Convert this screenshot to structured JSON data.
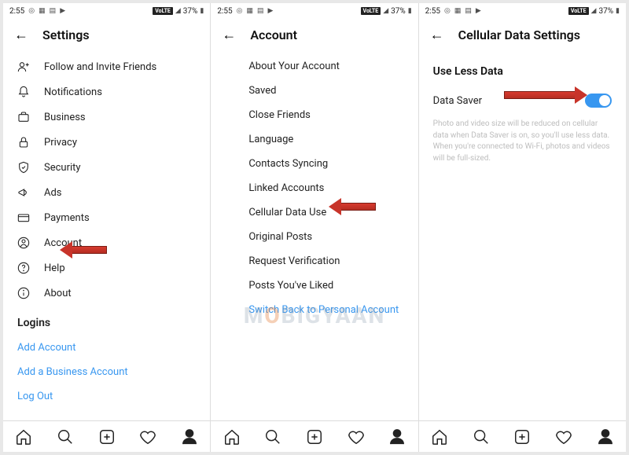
{
  "statusbar": {
    "time": "2:55",
    "network_badge": "VoLTE",
    "battery_pct": "37%"
  },
  "panel1": {
    "title": "Settings",
    "items": [
      {
        "label": "Follow and Invite Friends",
        "icon": "user-plus"
      },
      {
        "label": "Notifications",
        "icon": "bell"
      },
      {
        "label": "Business",
        "icon": "briefcase"
      },
      {
        "label": "Privacy",
        "icon": "lock"
      },
      {
        "label": "Security",
        "icon": "shield"
      },
      {
        "label": "Ads",
        "icon": "megaphone"
      },
      {
        "label": "Payments",
        "icon": "card"
      },
      {
        "label": "Account",
        "icon": "user-circle"
      },
      {
        "label": "Help",
        "icon": "help"
      },
      {
        "label": "About",
        "icon": "info"
      }
    ],
    "logins_title": "Logins",
    "logins": [
      {
        "label": "Add Account"
      },
      {
        "label": "Add a Business Account"
      },
      {
        "label": "Log Out"
      }
    ]
  },
  "panel2": {
    "title": "Account",
    "items": [
      {
        "label": "About Your Account"
      },
      {
        "label": "Saved"
      },
      {
        "label": "Close Friends"
      },
      {
        "label": "Language"
      },
      {
        "label": "Contacts Syncing"
      },
      {
        "label": "Linked Accounts"
      },
      {
        "label": "Cellular Data Use"
      },
      {
        "label": "Original Posts"
      },
      {
        "label": "Request Verification"
      },
      {
        "label": "Posts You've Liked"
      }
    ],
    "switch_link": "Switch Back to Personal Account"
  },
  "panel3": {
    "title": "Cellular Data Settings",
    "section_title": "Use Less Data",
    "toggle_label": "Data Saver",
    "toggle_on": true,
    "help_text": "Photo and video size will be reduced on cellular data when Data Saver is on, so you'll use less data. When you're connected to Wi-Fi, photos and videos will be full-sized."
  },
  "watermark": "MOBIGYAAN"
}
